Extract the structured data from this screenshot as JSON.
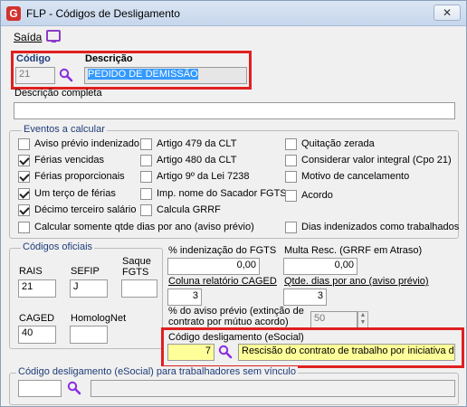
{
  "window": {
    "title": "FLP - Códigos de Desligamento",
    "close_label": "✕"
  },
  "menu": {
    "saida_label": "Saída"
  },
  "header": {
    "codigo_label": "Código",
    "codigo_value": "21",
    "descricao_label": "Descrição",
    "descricao_value": "PEDIDO DE DEMISSÃO",
    "descricao_completa_label": "Descrição completa",
    "descricao_completa_value": ""
  },
  "eventos": {
    "title": "Eventos a calcular",
    "items": [
      {
        "label": "Aviso prévio indenizado",
        "checked": false
      },
      {
        "label": "Férias vencidas",
        "checked": true
      },
      {
        "label": "Férias proporcionais",
        "checked": true
      },
      {
        "label": "Um terço de férias",
        "checked": true
      },
      {
        "label": "Décimo terceiro salário",
        "checked": true
      },
      {
        "label": "Calcular somente qtde dias por ano (aviso prévio)",
        "checked": false
      },
      {
        "label": "Artigo 479 da CLT",
        "checked": false
      },
      {
        "label": "Artigo 480 da CLT",
        "checked": false
      },
      {
        "label": "Artigo 9º da Lei 7238",
        "checked": false
      },
      {
        "label": "Imp. nome do Sacador FGTS",
        "checked": false
      },
      {
        "label": "Calcula GRRF",
        "checked": false
      },
      {
        "label": "Quitação zerada",
        "checked": false
      },
      {
        "label": "Considerar valor integral (Cpo 21)",
        "checked": false
      },
      {
        "label": "Motivo de cancelamento",
        "checked": false
      },
      {
        "label": "Acordo",
        "checked": false
      },
      {
        "label": "Dias indenizados como trabalhados",
        "checked": false
      }
    ]
  },
  "codigos_oficiais": {
    "title": "Códigos oficiais",
    "rais_label": "RAIS",
    "rais_value": "21",
    "sefip_label": "SEFIP",
    "sefip_value": "J",
    "saque_label_1": "Saque",
    "saque_label_2": "FGTS",
    "saque_value": "",
    "caged_label": "CAGED",
    "caged_value": "40",
    "homolognet_label": "HomologNet",
    "homolognet_value": ""
  },
  "valores": {
    "indenizacao_fgts_label": "% indenização do FGTS",
    "indenizacao_fgts_value": "0,00",
    "multa_resc_label": "Multa Resc. (GRRF em Atraso)",
    "multa_resc_value": "0,00",
    "coluna_caged_label": "Coluna relatório CAGED",
    "coluna_caged_value": "3",
    "qtde_dias_label": "Qtde. dias por ano (aviso prévio)",
    "qtde_dias_value": "3",
    "pct_aviso_label_1": "% do aviso prévio (extinção de",
    "pct_aviso_label_2": "contrato por mútuo acordo)",
    "pct_aviso_value": "50"
  },
  "esocial": {
    "label": "Código desligamento (eSocial)",
    "code_value": "7",
    "description_value": "Rescisão do contrato de trabalho por iniciativa do"
  },
  "sem_vinculo": {
    "label": "Código desligamento (eSocial) para trabalhadores sem vínculo",
    "code_value": "",
    "description_value": ""
  },
  "icons": {
    "app": "G",
    "search": "magnifier-icon",
    "screen": "monitor-icon"
  }
}
